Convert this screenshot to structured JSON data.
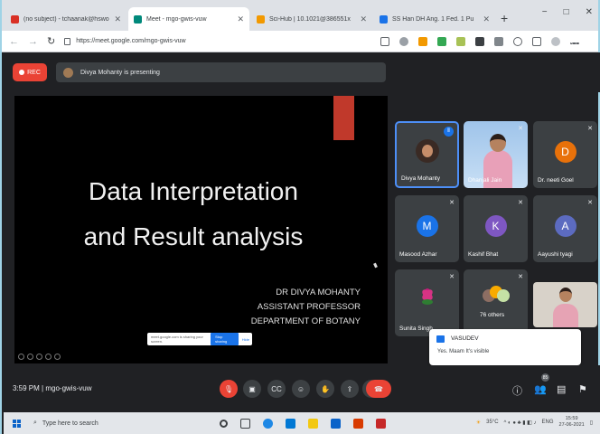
{
  "browser": {
    "tabs": [
      {
        "title": "(no subject) - tchaanak@hswo",
        "favicon_color": "#d93025",
        "active": false
      },
      {
        "title": "Meet - mgo-gwis-vuw",
        "favicon_color": "#00897b",
        "active": true
      },
      {
        "title": "Sci-Hub | 10.1021@386551x",
        "favicon_color": "#f29900",
        "active": false
      },
      {
        "title": "SS Han DH Ang. 1 Fed. 1 Pu",
        "favicon_color": "#1a73e8",
        "active": false
      }
    ],
    "new_tab_label": "+",
    "url": "https://meet.google.com/mgo-gwis-vuw",
    "window_controls": [
      "−",
      "□",
      "✕"
    ]
  },
  "meet": {
    "rec_label": "REC",
    "presenting_text": "Divya Mohanty is presenting",
    "slide": {
      "title_line1": "Data Interpretation",
      "title_line2": "and Result analysis",
      "author_lines": [
        "DR DIVYA MOHANTY",
        "ASSISTANT PROFESSOR",
        "DEPARTMENT OF BOTANY"
      ]
    },
    "share_notice": {
      "text": "meet.google.com is sharing your screen.",
      "stop_label": "Stop sharing",
      "hide_label": "Hide"
    },
    "participants": [
      {
        "name": "Divya Mohanty",
        "kind": "photo",
        "speaking": true
      },
      {
        "name": "Dhanjali Jain",
        "kind": "video"
      },
      {
        "name": "Dr. neeti Goel",
        "kind": "initial",
        "initial": "D",
        "color": "#e8710a"
      },
      {
        "name": "Masood Azhar",
        "kind": "initial",
        "initial": "M",
        "color": "#1a73e8"
      },
      {
        "name": "Kashif Bhat",
        "kind": "initial",
        "initial": "K",
        "color": "#7e57c2"
      },
      {
        "name": "Aayushi tyagi",
        "kind": "initial",
        "initial": "A",
        "color": "#5c6bc0"
      },
      {
        "name": "Sunita Singh",
        "kind": "lotus"
      },
      {
        "name": "76 others",
        "kind": "others"
      }
    ],
    "toast": {
      "sender": "VASUDEV",
      "message": "Yes. Maam It's visible"
    },
    "time": "3:59 PM",
    "meeting_code": "mgo-gwis-vuw",
    "people_count": "85"
  },
  "taskbar": {
    "search_placeholder": "Type here to search",
    "weather": "35°C",
    "language": "ENG",
    "clock_time": "15:59",
    "clock_date": "27-06-2021"
  }
}
